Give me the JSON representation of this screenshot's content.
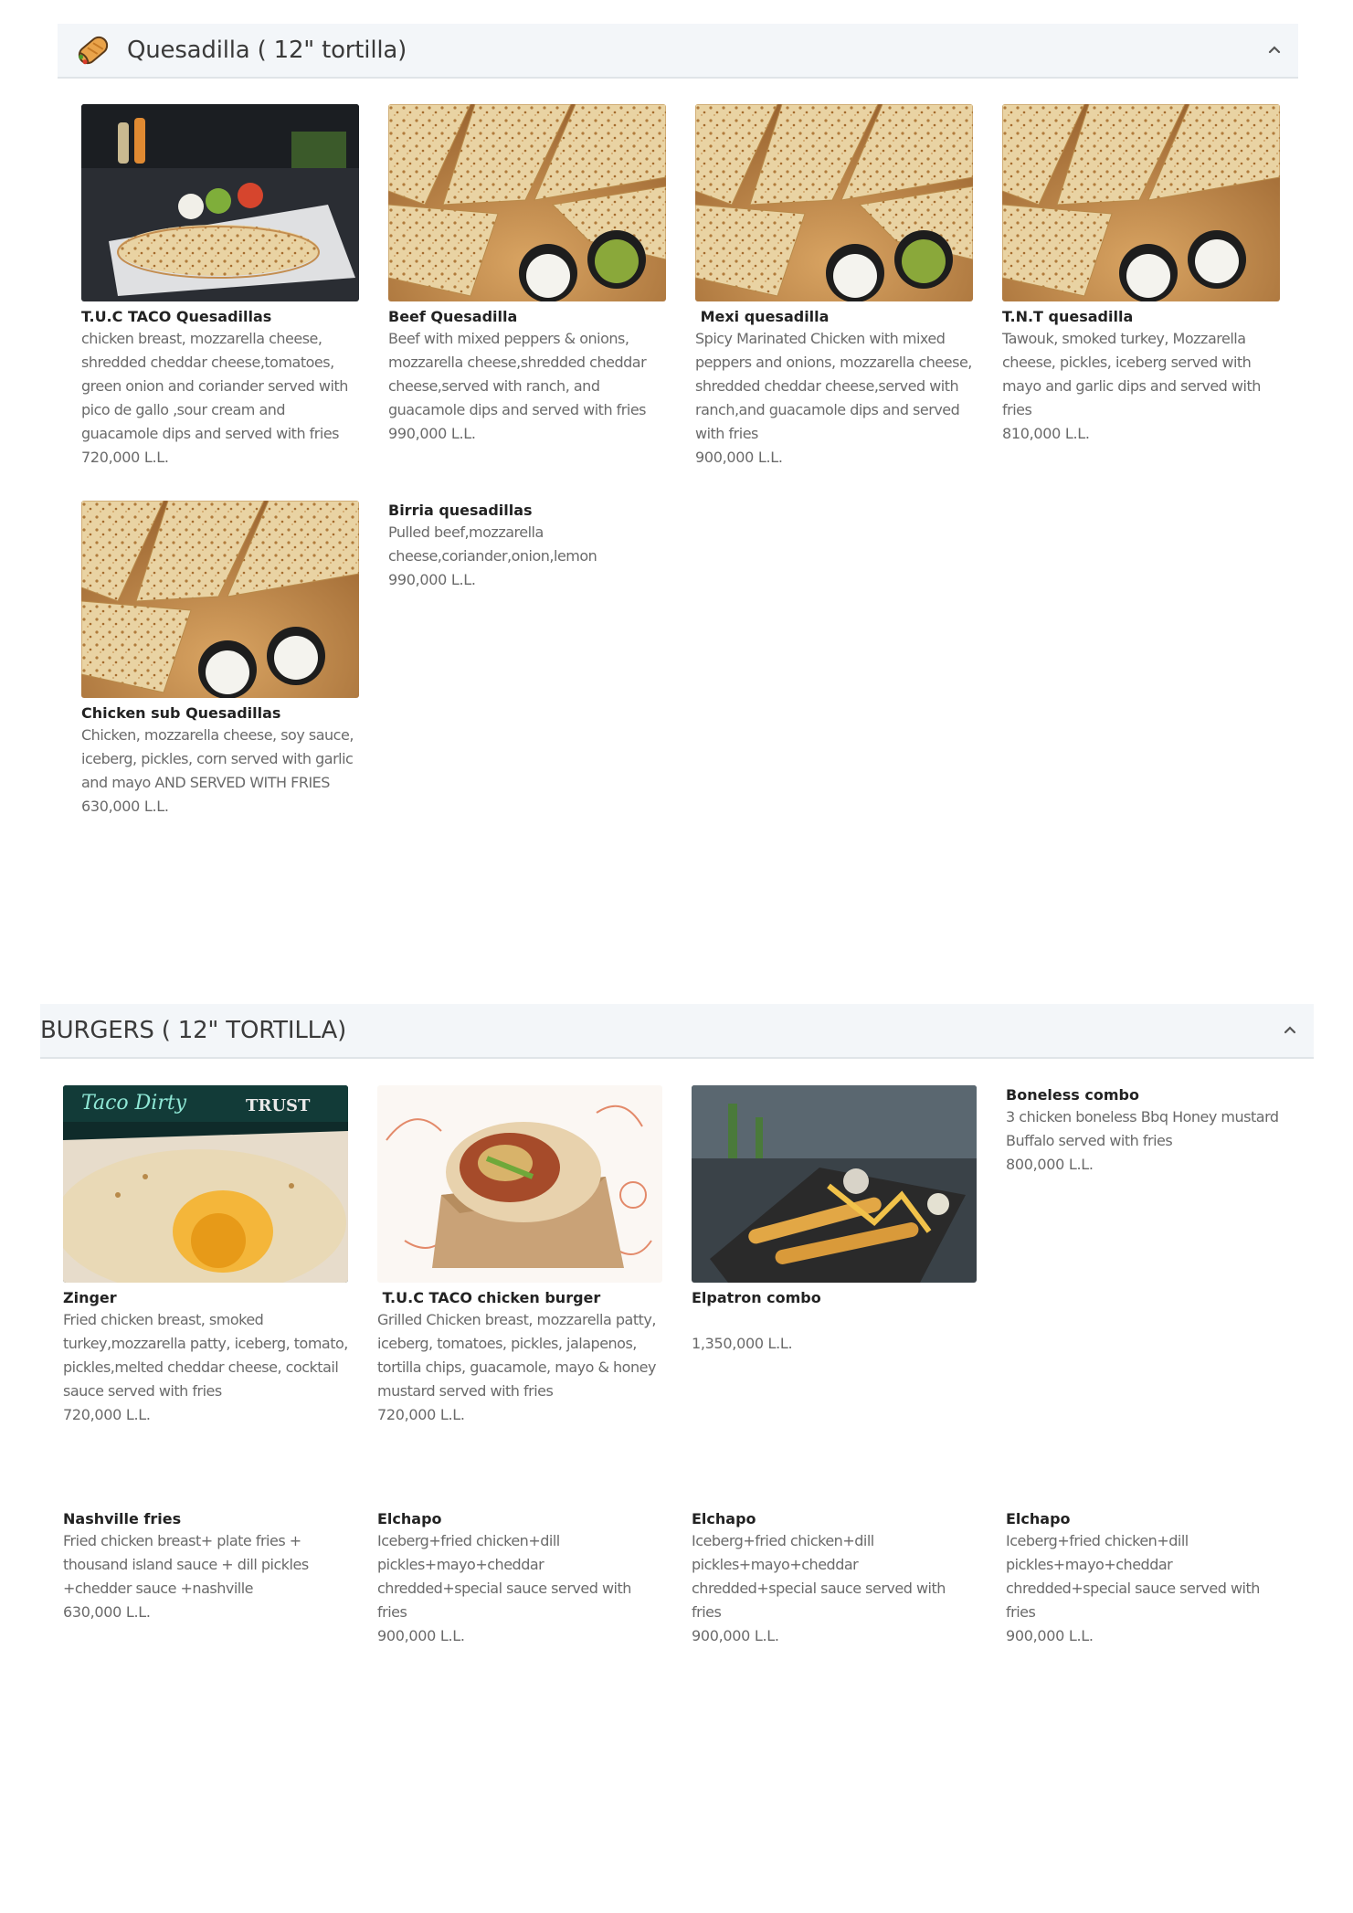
{
  "sections": {
    "quesadilla": {
      "title": "Quesadilla ( 12\" tortilla)",
      "icon": "burrito-icon",
      "collapse_icon": "chevron-up-icon",
      "items": [
        {
          "name": "T.U.C TACO Quesadillas",
          "description": "chicken breast, mozzarella cheese, shredded cheddar cheese,tomatoes, green onion and coriander served with pico de gallo ,sour cream and guacamole dips and served with fries",
          "price": "720,000 L.L."
        },
        {
          "name": "Beef Quesadilla",
          "description": "Beef with mixed peppers & onions, mozzarella cheese,shredded cheddar cheese,served with ranch, and guacamole dips and served with fries",
          "price": "990,000 L.L."
        },
        {
          "name": " Mexi quesadilla",
          "description": "Spicy Marinated Chicken with mixed peppers and onions, mozzarella cheese, shredded cheddar cheese,served with ranch,and guacamole dips and served with fries",
          "price": "900,000 L.L."
        },
        {
          "name": "T.N.T quesadilla",
          "description": "Tawouk, smoked turkey, Mozzarella cheese, pickles, iceberg served with mayo and garlic dips and served with fries",
          "price": "810,000 L.L."
        },
        {
          "name": "Chicken sub Quesadillas",
          "description": "Chicken, mozzarella cheese, soy sauce, iceberg, pickles, corn served with garlic and mayo AND SERVED WITH FRIES",
          "price": "630,000 L.L."
        },
        {
          "name": "Birria quesadillas",
          "description": "Pulled beef,mozzarella cheese,coriander,onion,lemon",
          "price": "990,000 L.L."
        }
      ]
    },
    "burgers": {
      "title": "BURGERS ( 12\" TORTILLA)",
      "collapse_icon": "chevron-up-icon",
      "items": [
        {
          "name": "Zinger",
          "description": "Fried chicken breast, smoked turkey,mozzarella patty, iceberg, tomato, pickles,melted cheddar cheese, cocktail sauce served with fries",
          "price": "720,000 L.L."
        },
        {
          "name": " T.U.C TACO chicken burger",
          "description": "Grilled Chicken breast, mozzarella patty, iceberg, tomatoes, pickles, jalapenos, tortilla chips, guacamole, mayo & honey mustard served with fries",
          "price": "720,000 L.L."
        },
        {
          "name": "Elpatron combo",
          "description": "",
          "price": "1,350,000 L.L."
        },
        {
          "name": "Boneless combo",
          "description": "3 chicken boneless Bbq Honey mustard Buffalo served with fries",
          "price": "800,000 L.L."
        },
        {
          "name": "Nashville fries",
          "description": "Fried chicken breast+ plate fries + thousand island sauce + dill pickles +chedder sauce +nashville",
          "price": "630,000 L.L."
        },
        {
          "name": "Elchapo",
          "description": "Iceberg+fried chicken+dill pickles+mayo+cheddar chredded+special sauce served with fries",
          "price": "900,000 L.L."
        },
        {
          "name": "Elchapo",
          "description": "Iceberg+fried chicken+dill pickles+mayo+cheddar chredded+special sauce served with fries",
          "price": "900,000 L.L."
        },
        {
          "name": "Elchapo",
          "description": "Iceberg+fried chicken+dill pickles+mayo+cheddar chredded+special sauce served with fries",
          "price": "900,000 L.L."
        }
      ]
    }
  },
  "image_icons": {
    "q0": "quesadilla-platter-photo",
    "q1": "quesadilla-wedges-photo",
    "b0": "zinger-photo",
    "b1": "wrap-photo",
    "b2": "combo-platter-photo"
  },
  "colors": {
    "header_bg": "#f3f6f9",
    "title": "#3a3a3a",
    "name": "#222222",
    "text": "#6a6a6a"
  }
}
